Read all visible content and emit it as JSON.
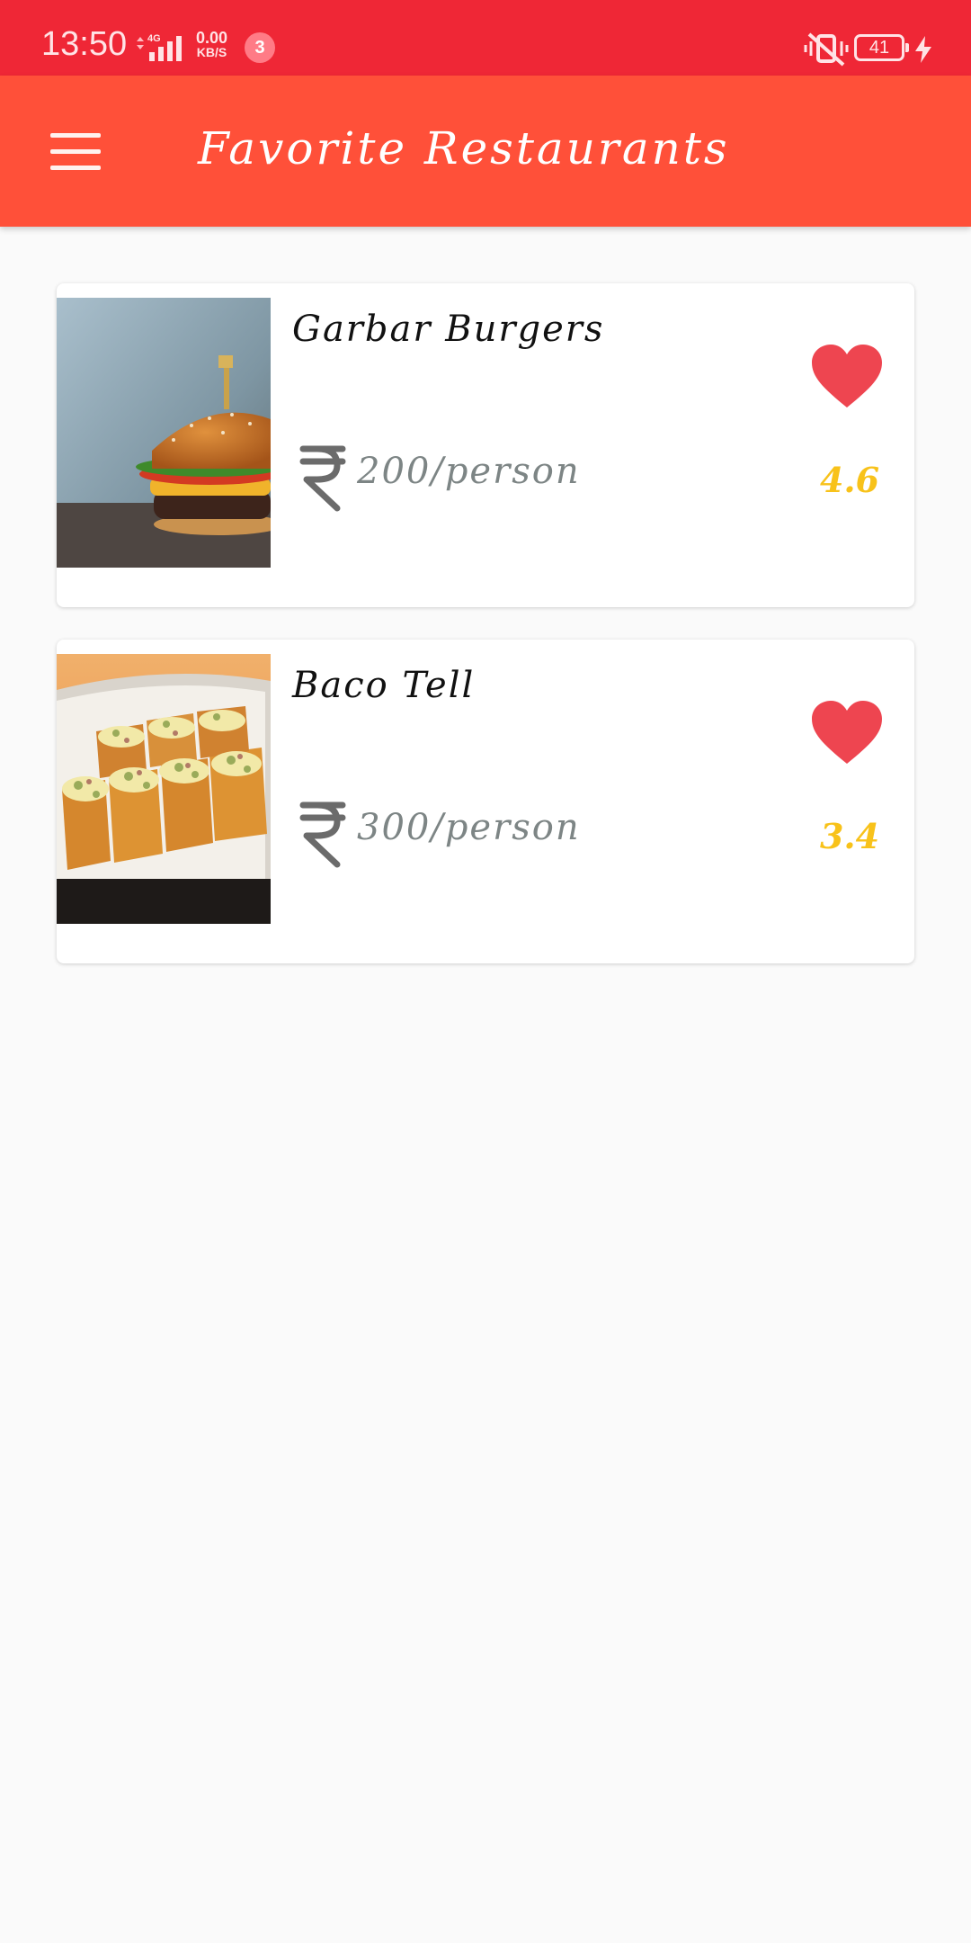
{
  "status_bar": {
    "time": "13:50",
    "network_type": "4G",
    "data_rate_value": "0.00",
    "data_rate_unit": "KB/S",
    "notification_count": "3",
    "battery_level": "41"
  },
  "app_bar": {
    "title": "Favorite Restaurants"
  },
  "restaurants": [
    {
      "name": "Garbar Burgers",
      "price": "200/person",
      "rating": "4.6",
      "favorite": true
    },
    {
      "name": "Baco Tell",
      "price": "300/person",
      "rating": "3.4",
      "favorite": true
    }
  ],
  "colors": {
    "status_bar": "#ef2736",
    "app_bar": "#ff5039",
    "heart": "#ee4550",
    "rating": "#f8c21a",
    "price": "#7d8585"
  }
}
